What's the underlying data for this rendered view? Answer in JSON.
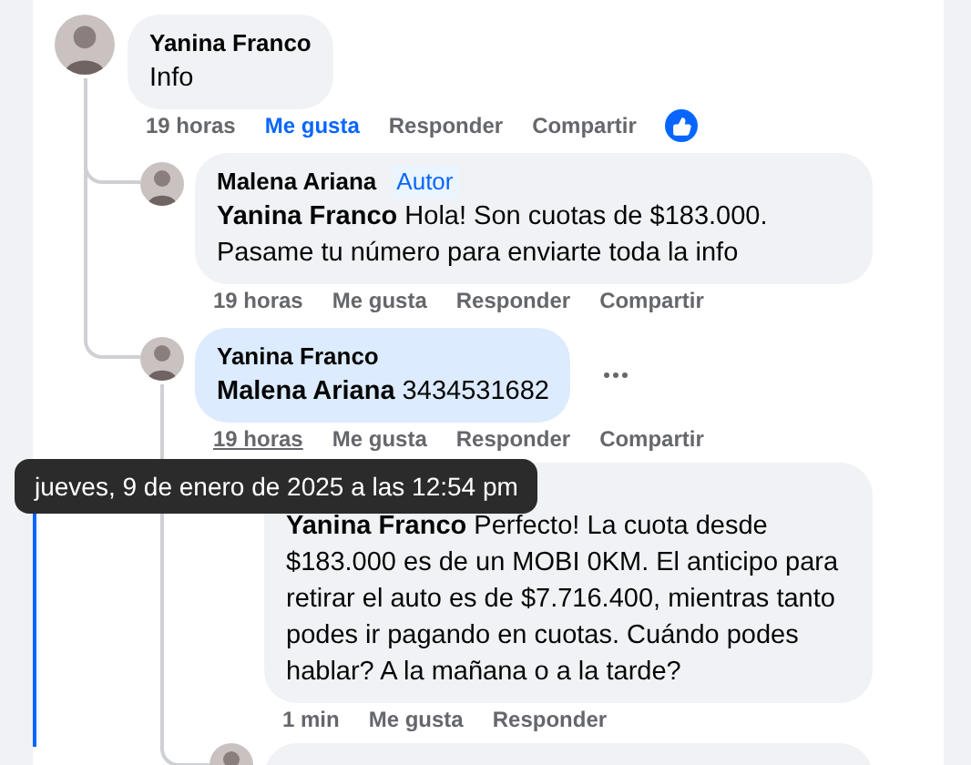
{
  "comments": [
    {
      "author": "Yanina Franco",
      "text": "Info",
      "time": "19 horas",
      "time_hovered": false,
      "like_label": "Me gusta",
      "liked": true,
      "reply_label": "Responder",
      "share_label": "Compartir",
      "highlighted": false,
      "children": [
        {
          "author": "Malena Ariana",
          "badge": "Autor",
          "text": "**Yanina Franco** Hola! Son cuotas de $183.000. Pasame tu número para enviarte toda la info",
          "time": "19 horas",
          "time_hovered": false,
          "like_label": "Me gusta",
          "liked": false,
          "reply_label": "Responder",
          "share_label": "Compartir",
          "highlighted": false
        },
        {
          "author": "Yanina Franco",
          "text": "**Malena Ariana** 3434531682",
          "time": "19 horas",
          "time_hovered": true,
          "like_label": "Me gusta",
          "liked": false,
          "reply_label": "Responder",
          "share_label": "Compartir",
          "highlighted": true,
          "children": [
            {
              "text": "**Yanina Franco** Perfecto! La cuota desde $183.000 es de un MOBI 0KM. El anticipo para retirar el auto es de $7.716.400, mientras tanto podes ir pagando en cuotas. Cuándo podes hablar? A la mañana o a la tarde?",
              "time": "1 min",
              "time_hovered": false,
              "like_label": "Me gusta",
              "liked": false,
              "reply_label": "Responder",
              "highlighted": false
            },
            {
              "kind": "clipped"
            }
          ]
        }
      ]
    }
  ],
  "tooltip": {
    "text": "jueves, 9 de enero de 2025 a las 12:54 pm"
  }
}
